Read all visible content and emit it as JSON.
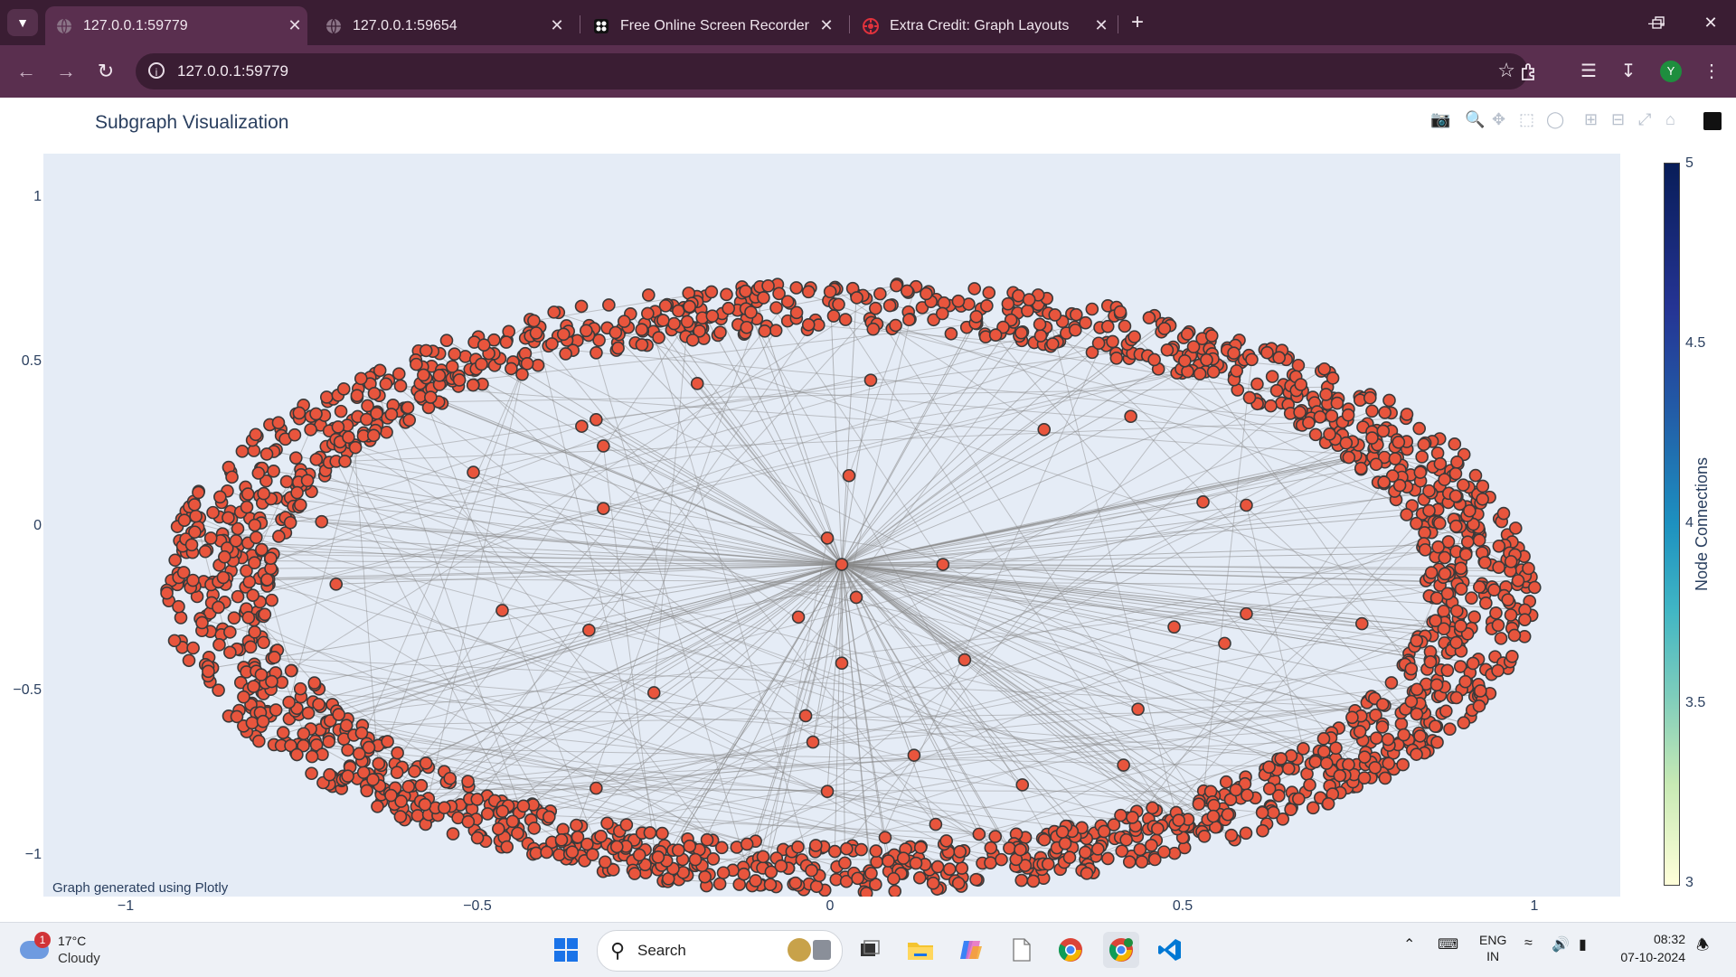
{
  "browser": {
    "tabs": [
      {
        "title": "127.0.0.1:59779",
        "active": true,
        "icon": "globe-icon"
      },
      {
        "title": "127.0.0.1:59654",
        "active": false,
        "icon": "globe-icon"
      },
      {
        "title": "Free Online Screen Recorder | C",
        "active": false,
        "icon": "recorder-icon"
      },
      {
        "title": "Extra Credit: Graph Layouts",
        "active": false,
        "icon": "graph-site-icon"
      }
    ],
    "url": "127.0.0.1:59779",
    "profile_initial": "Y"
  },
  "plot": {
    "title": "Subgraph Visualization",
    "annotation": "Graph generated using Plotly",
    "yticks": [
      "1",
      "0.5",
      "0",
      "−0.5",
      "−1"
    ],
    "xticks": [
      "−1",
      "−0.5",
      "0",
      "0.5",
      "1"
    ],
    "colorbar": {
      "title": "Node Connections",
      "ticks": [
        "5",
        "4.5",
        "4",
        "3.5",
        "3"
      ]
    },
    "node_color": "#e8553d",
    "edge_color": "#888888",
    "background": "#e5ecf6"
  },
  "chart_data": {
    "type": "scatter",
    "title": "Subgraph Visualization",
    "xlabel": "",
    "ylabel": "",
    "xlim": [
      -1.1,
      1.12
    ],
    "ylim": [
      -1.1,
      1.12
    ],
    "grid": false,
    "colorbar_title": "Node Connections",
    "colorbar_range": [
      3,
      5
    ],
    "hub": {
      "x": -0.01,
      "y": 0.07
    },
    "inner_nodes": [
      [
        -0.21,
        0.62
      ],
      [
        0.03,
        0.63
      ],
      [
        -0.37,
        0.49
      ],
      [
        -0.35,
        0.51
      ],
      [
        -0.34,
        0.43
      ],
      [
        -0.52,
        0.35
      ],
      [
        0.0,
        0.34
      ],
      [
        0.27,
        0.48
      ],
      [
        0.39,
        0.52
      ],
      [
        -0.34,
        0.24
      ],
      [
        0.49,
        0.26
      ],
      [
        0.55,
        0.25
      ],
      [
        -0.73,
        0.2
      ],
      [
        -0.03,
        0.15
      ],
      [
        0.13,
        0.07
      ],
      [
        -0.71,
        0.01
      ],
      [
        0.01,
        -0.03
      ],
      [
        -0.48,
        -0.07
      ],
      [
        -0.07,
        -0.09
      ],
      [
        -0.36,
        -0.13
      ],
      [
        0.55,
        -0.08
      ],
      [
        0.45,
        -0.12
      ],
      [
        0.52,
        -0.17
      ],
      [
        0.71,
        -0.11
      ],
      [
        0.16,
        -0.22
      ],
      [
        -0.01,
        -0.23
      ],
      [
        -0.27,
        -0.32
      ],
      [
        -0.06,
        -0.39
      ],
      [
        -0.05,
        -0.47
      ],
      [
        0.09,
        -0.51
      ],
      [
        0.4,
        -0.37
      ],
      [
        -0.35,
        -0.61
      ],
      [
        -0.03,
        -0.62
      ],
      [
        0.38,
        -0.54
      ],
      [
        0.24,
        -0.6
      ],
      [
        0.42,
        -0.67
      ],
      [
        0.12,
        -0.72
      ],
      [
        0.05,
        -0.76
      ],
      [
        0.18,
        -0.75
      ],
      [
        -0.62,
        -0.65
      ],
      [
        -0.74,
        -0.29
      ]
    ],
    "ring": {
      "center": [
        0.0,
        0.0
      ],
      "radius_x": 0.95,
      "radius_y": 0.93,
      "approx_node_count": 1800
    },
    "colors": {
      "nodes": "#e8553d",
      "node_outline": "#3a3a3a",
      "edges": "#888888"
    }
  },
  "taskbar": {
    "weather_temp": "17°C",
    "weather_cond": "Cloudy",
    "weather_badge": "1",
    "search_label": "Search",
    "lang_top": "ENG",
    "lang_bottom": "IN",
    "time": "08:32",
    "date": "07-10-2024"
  }
}
